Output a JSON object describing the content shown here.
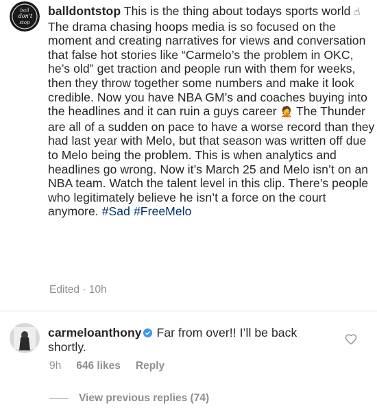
{
  "post_comment": {
    "username": "balldontstop",
    "avatar_text": [
      "ball",
      "don't",
      "stop"
    ],
    "text_before_emoji1": " This is the thing about todays sports world ",
    "emoji1": "☝",
    "text_mid": " The drama chasing hoops media is so focused on the moment and creating narratives for views and conversation that false hot stories like “Carmelo’s the problem in OKC, he’s old” get traction and people run with them for weeks, then they throw together some numbers and make it look credible. Now you have NBA GM’s and coaches buying into the headlines and it can ruin a guys career ",
    "emoji2": "🤦",
    "text_after": " The Thunder are all of a sudden on pace to have a worse record than they had last year with Melo, but that season was written off due to Melo being the problem. This is when analytics and headlines go wrong. Now it’s March 25 and Melo isn’t on an NBA team. Watch the talent level in this clip. There’s people who legitimately believe he isn’t a force on the court anymore. ",
    "hashtag1": "#Sad",
    "hashtag2": "#FreeMelo",
    "meta": "Edited · 10h"
  },
  "reply_comment": {
    "username": "carmeloanthony",
    "verified": true,
    "text": " Far from over!! I’ll be back shortly.",
    "time": "9h",
    "likes": "646 likes",
    "reply_label": "Reply"
  },
  "view_previous_replies": "View previous replies (74)",
  "colors": {
    "text": "#262626",
    "secondary": "#8e8e8e",
    "hashtag": "#003569",
    "verified": "#3897f0"
  },
  "icons": [
    "verified-badge-icon",
    "heart-icon"
  ]
}
